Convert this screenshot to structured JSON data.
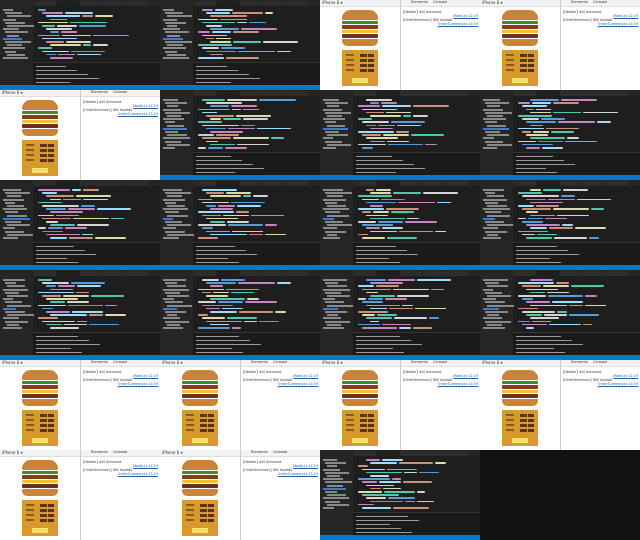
{
  "editor": {
    "window_title": "BurgerBuilder.js",
    "status_branch": "master"
  },
  "browser": {
    "device": "iPhone 6 ▾",
    "dimensions": "375 x 667",
    "devtools_tabs": [
      "Elements",
      "Console"
    ],
    "console_filter": "All levels",
    "logs": [
      {
        "text": "[Header]  will Unmount",
        "source": "Modal.js:12:19"
      },
      {
        "text": "[OrderSummary]  Will Update",
        "source": "OrderSummary.js:13:19"
      }
    ],
    "order_button_label": "ORDER NOW",
    "controls": [
      "Salad",
      "Bacon",
      "Cheese",
      "Meat"
    ]
  },
  "colors": {
    "editor_bg": "#1e1e1e",
    "status_bar": "#007acc",
    "bun": "#c8853a",
    "controls_bg": "#d89a2e",
    "order_button": "#f4e06b"
  }
}
